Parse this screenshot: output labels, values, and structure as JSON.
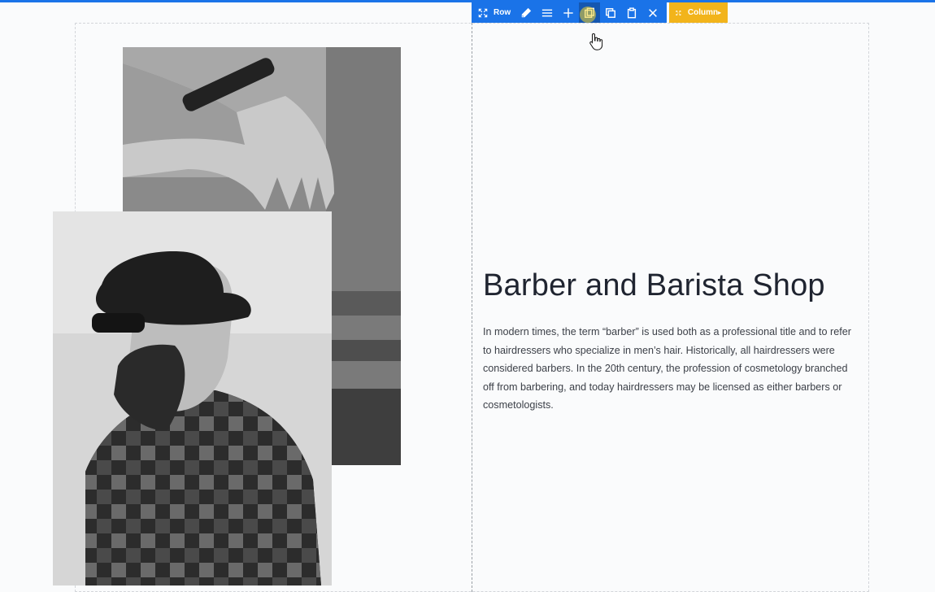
{
  "toolbar": {
    "row_label": "Row",
    "column_label": "Column",
    "column_arrow": "▸",
    "icons": [
      "move-icon",
      "edit-icon",
      "settings-icon",
      "add-icon",
      "duplicate-icon",
      "copy-icon",
      "paste-icon",
      "delete-icon"
    ]
  },
  "content": {
    "heading": "Barber and Barista Shop",
    "paragraph": "In modern times, the term “barber” is used both as a professional title and to refer to hairdressers who specialize in men’s hair. Historically, all hairdressers were considered barbers. In the 20th century, the profession of cosmetology branched off from barbering, and today hairdressers may be licensed as either barbers or cosmetologists."
  },
  "images": {
    "back_photo": "black-and-white hand with wristwatch",
    "front_photo": "black-and-white bearded man in hat and plaid shirt"
  },
  "colors": {
    "toolbar_blue": "#1a73e8",
    "column_orange": "#f2b41b",
    "heading": "#1f2430",
    "body_text": "#3c4048"
  }
}
